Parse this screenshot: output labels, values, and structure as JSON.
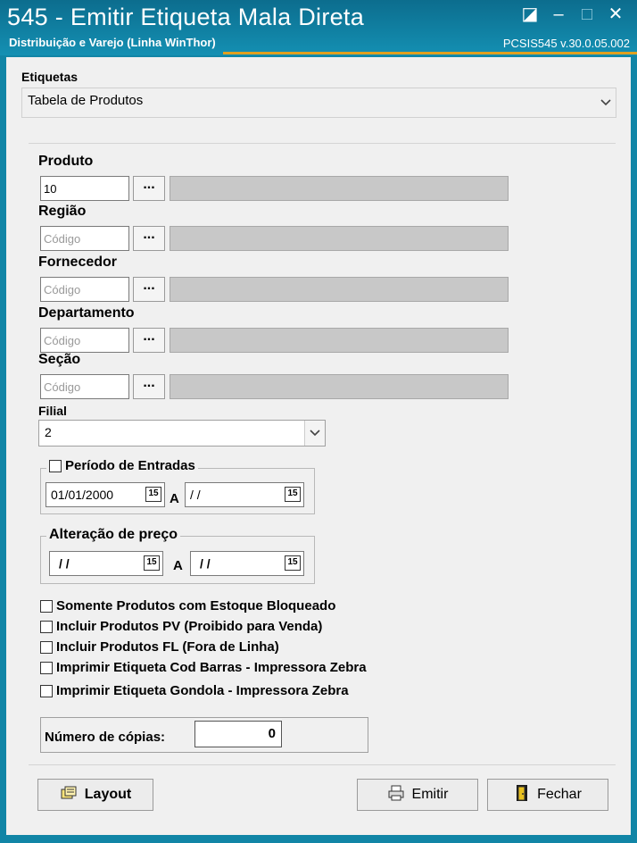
{
  "window": {
    "title": "545 - Emitir Etiqueta Mala Direta",
    "subtitle": "Distribuição e Varejo (Linha WinThor)",
    "version": "PCSIS545  v.30.0.05.002",
    "controls": {
      "restore": "◪",
      "minimize": "–",
      "maximize": "□",
      "close": "✕"
    }
  },
  "etiquetas": {
    "label": "Etiquetas",
    "selected": "Tabela de Produtos"
  },
  "filters": {
    "produto": {
      "label": "Produto",
      "value": "10"
    },
    "regiao": {
      "label": "Região",
      "placeholder": "Código"
    },
    "fornecedor": {
      "label": "Fornecedor",
      "placeholder": "Código"
    },
    "departamento": {
      "label": "Departamento",
      "placeholder": "Código"
    },
    "secao": {
      "label": "Seção",
      "placeholder": "Código"
    },
    "dots": "..."
  },
  "filial": {
    "label": "Filial",
    "selected": "2"
  },
  "periodo": {
    "label": "Período de Entradas",
    "from": "01/01/2000",
    "sep": "A",
    "to": " / /"
  },
  "alteracao": {
    "label": "Alteração de preço",
    "from": " /  /",
    "sep": "A",
    "to": " /  /"
  },
  "calendar_icon": "15",
  "options": [
    "Somente Produtos com Estoque Bloqueado",
    "Incluir Produtos PV (Proibido para Venda)",
    "Incluir Produtos FL (Fora de Linha)",
    "Imprimir Etiqueta Cod Barras - Impressora Zebra",
    "Imprimir Etiqueta Gondola - Impressora Zebra"
  ],
  "copies": {
    "label": "Número de cópias:",
    "value": "0"
  },
  "buttons": {
    "layout": "Layout",
    "emitir": "Emitir",
    "fechar": "Fechar"
  },
  "colors": {
    "titlebar": "#1185a6",
    "accent": "#e0a020",
    "client": "#f0f0f0"
  }
}
